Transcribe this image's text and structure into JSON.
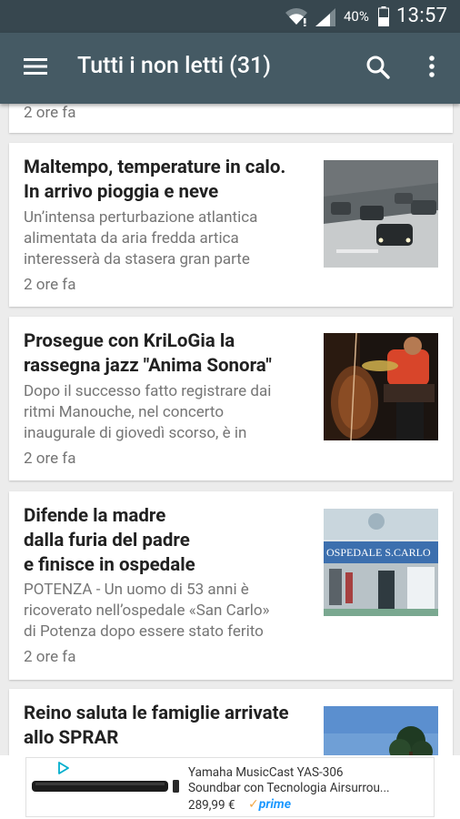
{
  "status_bar": {
    "battery": "40%",
    "time": "13:57"
  },
  "app_bar": {
    "title": "Tutti i non letti (31)"
  },
  "partial_top_card": {
    "time": "2 ore fa"
  },
  "articles": [
    {
      "title_lines": [
        "Maltempo, temperature in calo.",
        "In arrivo pioggia e neve"
      ],
      "summary_lines": [
        "Un’intensa perturbazione atlantica",
        "alimentata da aria fredda artica",
        "interesserà da stasera gran parte"
      ],
      "time": "2 ore fa",
      "thumbnail": "snowy-traffic-photo"
    },
    {
      "title_lines": [
        "Prosegue con KriLoGia la",
        "rassegna jazz \"Anima Sonora\""
      ],
      "summary_lines": [
        "Dopo il successo fatto registrare dai",
        "ritmi Manouche, nel concerto",
        "inaugurale di giovedì scorso, è in"
      ],
      "time": "2 ore fa",
      "thumbnail": "jazz-musicians-photo"
    },
    {
      "title_lines": [
        "Difende la madre",
        "dalla furia del padre",
        "e finisce in ospedale"
      ],
      "summary_lines": [
        "POTENZA - Un uomo di 53 anni è",
        "ricoverato nell’ospedale «San Carlo»",
        "di Potenza dopo essere stato ferito"
      ],
      "time": "2 ore fa",
      "thumbnail": "hospital-entrance-photo",
      "thumbnail_sign": "OSPEDALE S.CARLO"
    },
    {
      "title_lines": [
        "Reino saluta le famiglie arrivate",
        "allo SPRAR"
      ],
      "thumbnail": "tree-sky-photo"
    }
  ],
  "ad": {
    "title_lines": [
      "Yamaha MusicCast YAS-306",
      "Soundbar con Tecnologia Airsurrou..."
    ],
    "price": "289,99 €",
    "badge": "prime",
    "product": "soundbar"
  }
}
